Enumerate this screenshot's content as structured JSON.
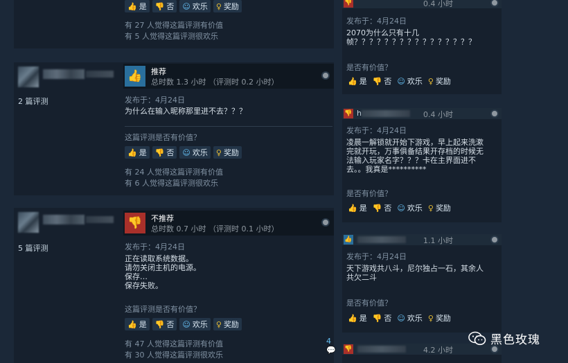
{
  "vote_labels": {
    "yes": "是",
    "no": "否",
    "funny": "欢乐",
    "award": "奖励"
  },
  "left_reviews": [
    {
      "tally_helpful": "有 27 人觉得这篇评测有价值",
      "tally_funny": "有 5 人觉得这篇评测很欢乐"
    },
    {
      "review_count": "2 篇评测",
      "verdict": "推荐",
      "hours": "总时数 1.3 小时  （评测时 0.2 小时）",
      "posted": "发布于：4月24日",
      "text": "为什么在输入昵称那里进不去？？？",
      "helpful_q": "这篇评测是否有价值？",
      "tally_helpful": "有 24 人觉得这篇评测有价值",
      "tally_funny": "有 6 人觉得这篇评测很欢乐"
    },
    {
      "review_count": "5 篇评测",
      "verdict": "不推荐",
      "hours": "总时数 0.7 小时  （评测时 0.1 小时）",
      "posted": "发布于：4月24日",
      "text": "正在读取系统数据。\n请勿关闭主机的电源。\n保存…\n保存失败。",
      "helpful_q": "这篇评测是否有价值？",
      "tally_helpful": "有 47 人觉得这篇评测有价值",
      "tally_funny": "有 30 人觉得这篇评测很欢乐",
      "comments": "4"
    }
  ],
  "right_reviews": [
    {
      "hours": "0.4 小时",
      "posted": "发布于：4月24日",
      "text": "2070为什么只有十几\n帧？？？？？？？？？？？？？？？？",
      "helpful_q": "是否有价值？"
    },
    {
      "hours": "0.4 小时",
      "name_initial": "h",
      "posted": "发布于：4月24日",
      "text": "凌晨一解锁就开始下游戏，早上起来洗漱\n完就开玩，万事俱备结果开存档的时候无\n法输入玩家名字？？？卡在主界面进不\n去。。我真是**********",
      "helpful_q": "是否有价值？"
    },
    {
      "hours": "1.1 小时",
      "posted": "发布于：4月24日",
      "text": "天下游戏共八斗，尼尔独占一石，其余人\n共欠二斗",
      "helpful_q": "是否有价值？"
    },
    {
      "hours": "4.2 小时"
    }
  ],
  "watermark": "黑色玫瑰"
}
